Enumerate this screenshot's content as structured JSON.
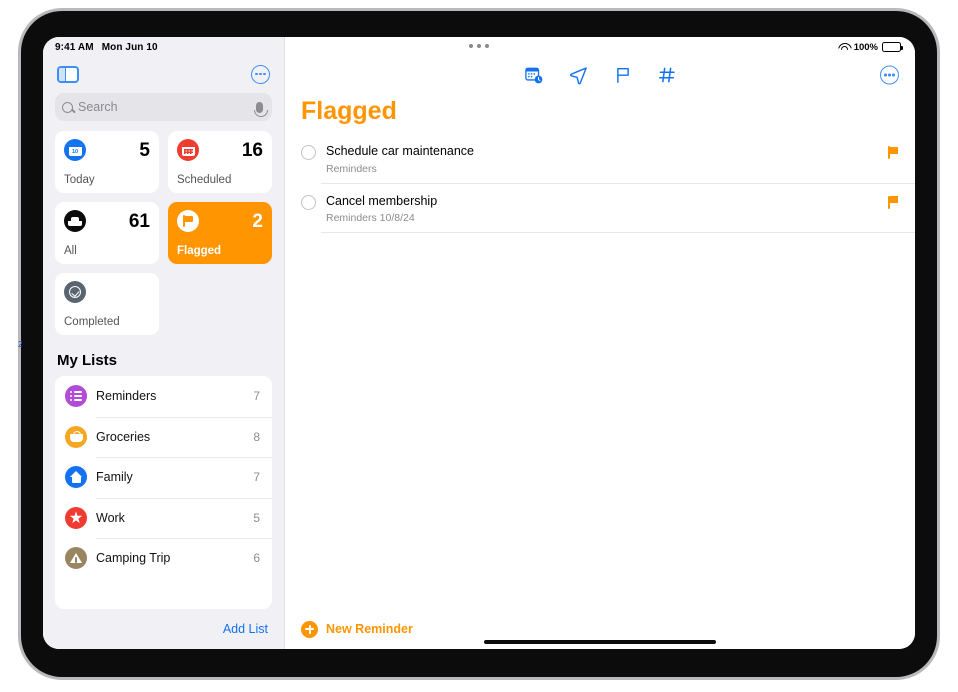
{
  "status_bar": {
    "time": "9:41 AM",
    "date": "Mon Jun 10",
    "wifi_icon": "wifi-icon",
    "battery_percent": "100%",
    "battery_icon": "battery-full-icon"
  },
  "sidebar": {
    "toggle_icon": "sidebar-toggle-icon",
    "more_icon": "more-options-icon",
    "search": {
      "placeholder": "Search",
      "value": "",
      "search_icon": "search-icon",
      "mic_icon": "microphone-icon"
    },
    "smart_lists": [
      {
        "label": "Today",
        "count": "5",
        "icon": "calendar-day-icon",
        "color": "#1272F0",
        "selected": false
      },
      {
        "label": "Scheduled",
        "count": "16",
        "icon": "calendar-icon",
        "color": "#EF3B30",
        "selected": false
      },
      {
        "label": "All",
        "count": "61",
        "icon": "inbox-tray-icon",
        "color": "#0B0B0C",
        "selected": false
      },
      {
        "label": "Flagged",
        "count": "2",
        "icon": "flag-icon",
        "color": "#FF9500",
        "selected": true
      },
      {
        "label": "Completed",
        "count": "",
        "icon": "check-circle-icon",
        "color": "#5B6570",
        "selected": false
      }
    ],
    "my_lists_title": "My Lists",
    "lists": [
      {
        "name": "Reminders",
        "count": "7",
        "icon": "bullet-list-icon",
        "color": "#B04CD8"
      },
      {
        "name": "Groceries",
        "count": "8",
        "icon": "basket-icon",
        "color": "#F5A623"
      },
      {
        "name": "Family",
        "count": "7",
        "icon": "house-icon",
        "color": "#1272F0"
      },
      {
        "name": "Work",
        "count": "5",
        "icon": "star-icon",
        "color": "#EF3B30"
      },
      {
        "name": "Camping Trip",
        "count": "6",
        "icon": "tent-icon",
        "color": "#9A8561"
      }
    ],
    "add_list_label": "Add List"
  },
  "main": {
    "toolbar_icons": [
      {
        "name": "calendar-clock-icon"
      },
      {
        "name": "location-arrow-icon"
      },
      {
        "name": "flag-outline-icon"
      },
      {
        "name": "hashtag-icon"
      }
    ],
    "more_icon": "more-options-icon",
    "title": "Flagged",
    "title_color": "#FF9500",
    "reminders": [
      {
        "title": "Schedule car maintenance",
        "subtitle": "Reminders",
        "flagged": true
      },
      {
        "title": "Cancel membership",
        "subtitle": "Reminders  10/8/24",
        "flagged": true
      }
    ],
    "new_reminder_label": "New Reminder",
    "add_icon": "plus-circle-icon"
  },
  "device": {
    "camera_dots": "camera-dots",
    "edge_marker": "2",
    "home_indicator": "home-indicator"
  }
}
